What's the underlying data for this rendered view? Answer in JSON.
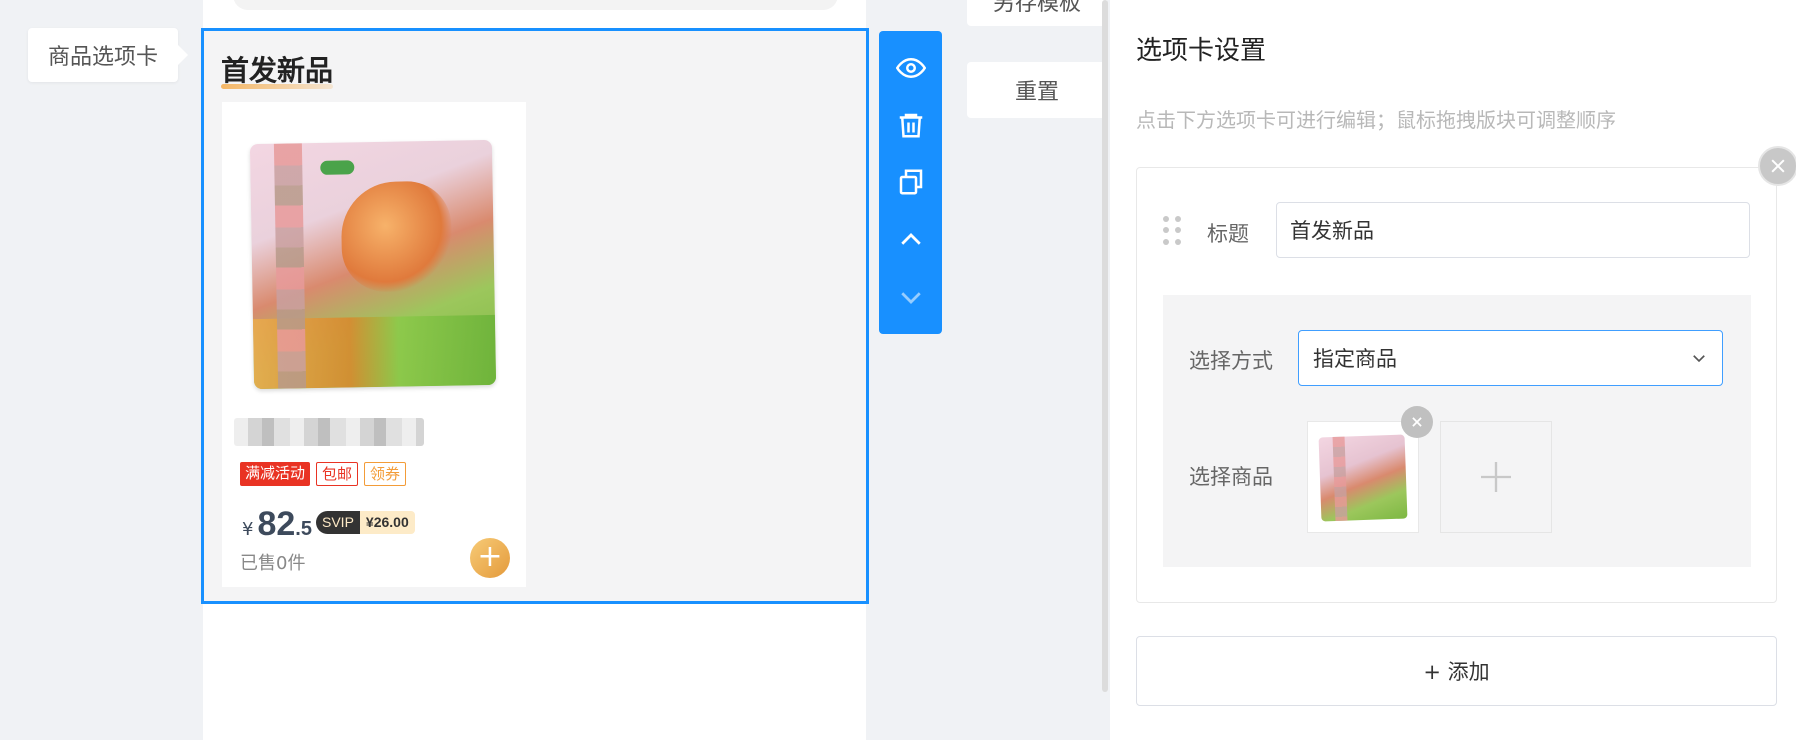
{
  "component_tag": "商品选项卡",
  "preview": {
    "section_title": "首发新品",
    "product": {
      "tags": [
        "满减活动",
        "包邮",
        "领券"
      ],
      "currency": "¥",
      "price_int": "82",
      "price_dec": ".5",
      "svip_label": "SVIP",
      "svip_price": "¥26.00",
      "sold": "已售0件",
      "add_icon": "+"
    }
  },
  "action_bar": {
    "icons": [
      "eye-icon",
      "trash-icon",
      "copy-icon",
      "chevron-up-icon",
      "chevron-down-icon"
    ]
  },
  "middle_buttons": {
    "save_template": "另存模板",
    "reset": "重置"
  },
  "settings": {
    "title": "选项卡设置",
    "hint": "点击下方选项卡可进行编辑；鼠标拖拽版块可调整顺序",
    "tab": {
      "title_label": "标题",
      "title_value": "首发新品",
      "mode_label": "选择方式",
      "mode_value": "指定商品",
      "goods_label": "选择商品"
    },
    "add_label": "+ 添加"
  },
  "colors": {
    "accent": "#1890ff",
    "price": "#3d4a5c",
    "tag_red": "#e93323",
    "tag_orange": "#f39c38"
  }
}
